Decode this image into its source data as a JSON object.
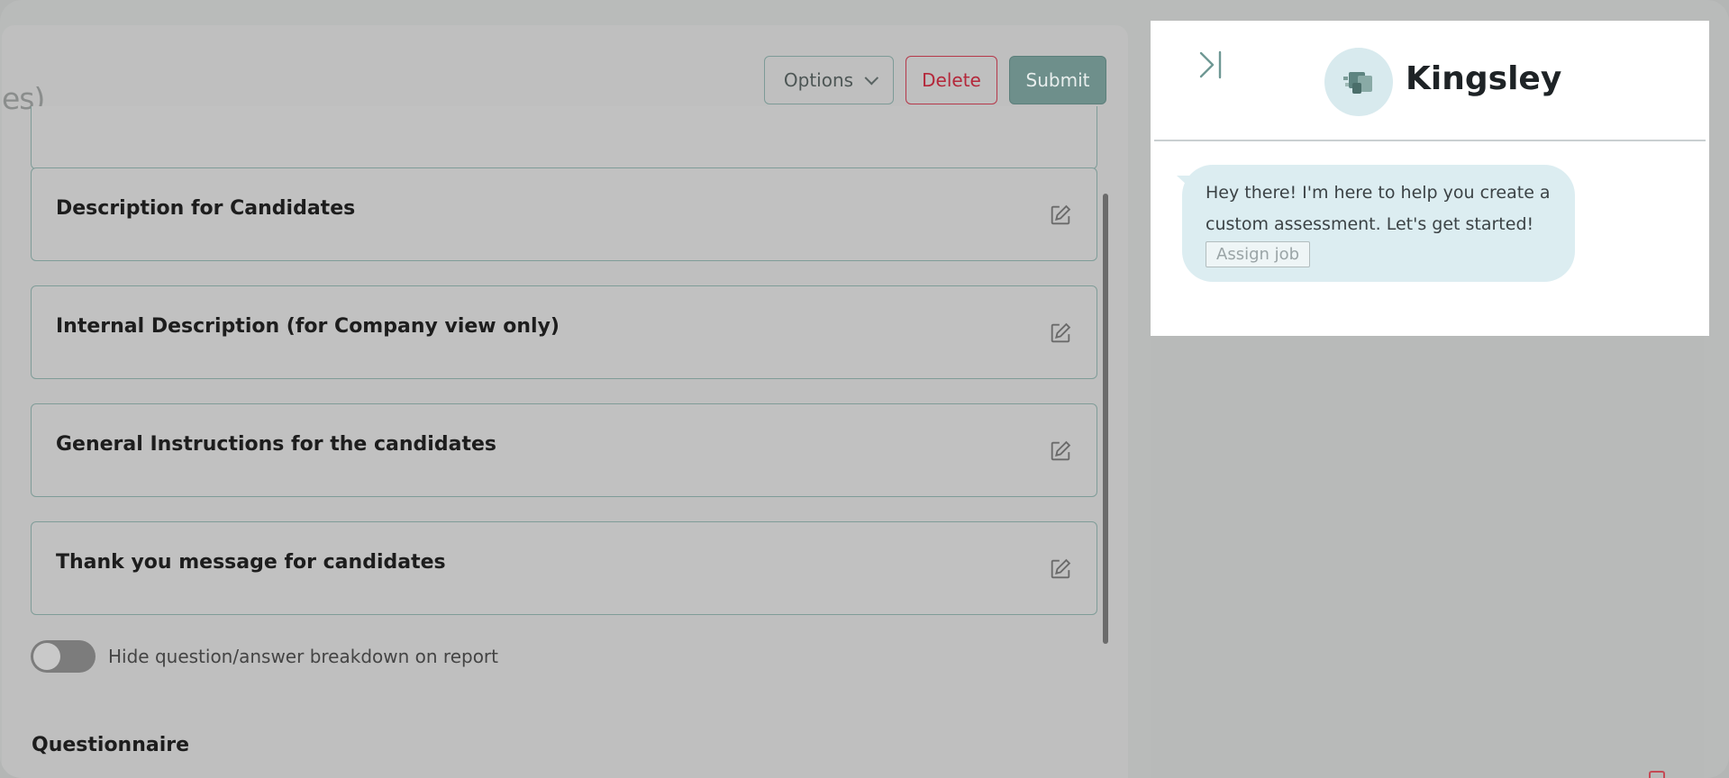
{
  "header": {
    "title_fragment": "es)"
  },
  "toolbar": {
    "options_label": "Options",
    "delete_label": "Delete",
    "submit_label": "Submit"
  },
  "sections": [
    {
      "label": "Description for Candidates"
    },
    {
      "label": "Internal Description (for Company view only)"
    },
    {
      "label": "General Instructions for the candidates"
    },
    {
      "label": "Thank you message for candidates"
    }
  ],
  "toggle": {
    "label": "Hide question/answer breakdown on report",
    "on": false
  },
  "questionnaire": {
    "title": "Questionnaire"
  },
  "chat": {
    "bot_name": "Kingsley",
    "message": "Hey there! I'm here to help you create a custom assessment. Let's get started!",
    "action_label": "Assign job"
  },
  "colors": {
    "accent": "#6e8f8b",
    "delete": "#b4273a",
    "bubble": "#dcedf1"
  },
  "icons": {
    "edit": "pencil-square-icon",
    "collapse": "collapse-panel-icon",
    "avatar": "robot-avatar-icon",
    "dropdown": "chevron-down-icon"
  }
}
